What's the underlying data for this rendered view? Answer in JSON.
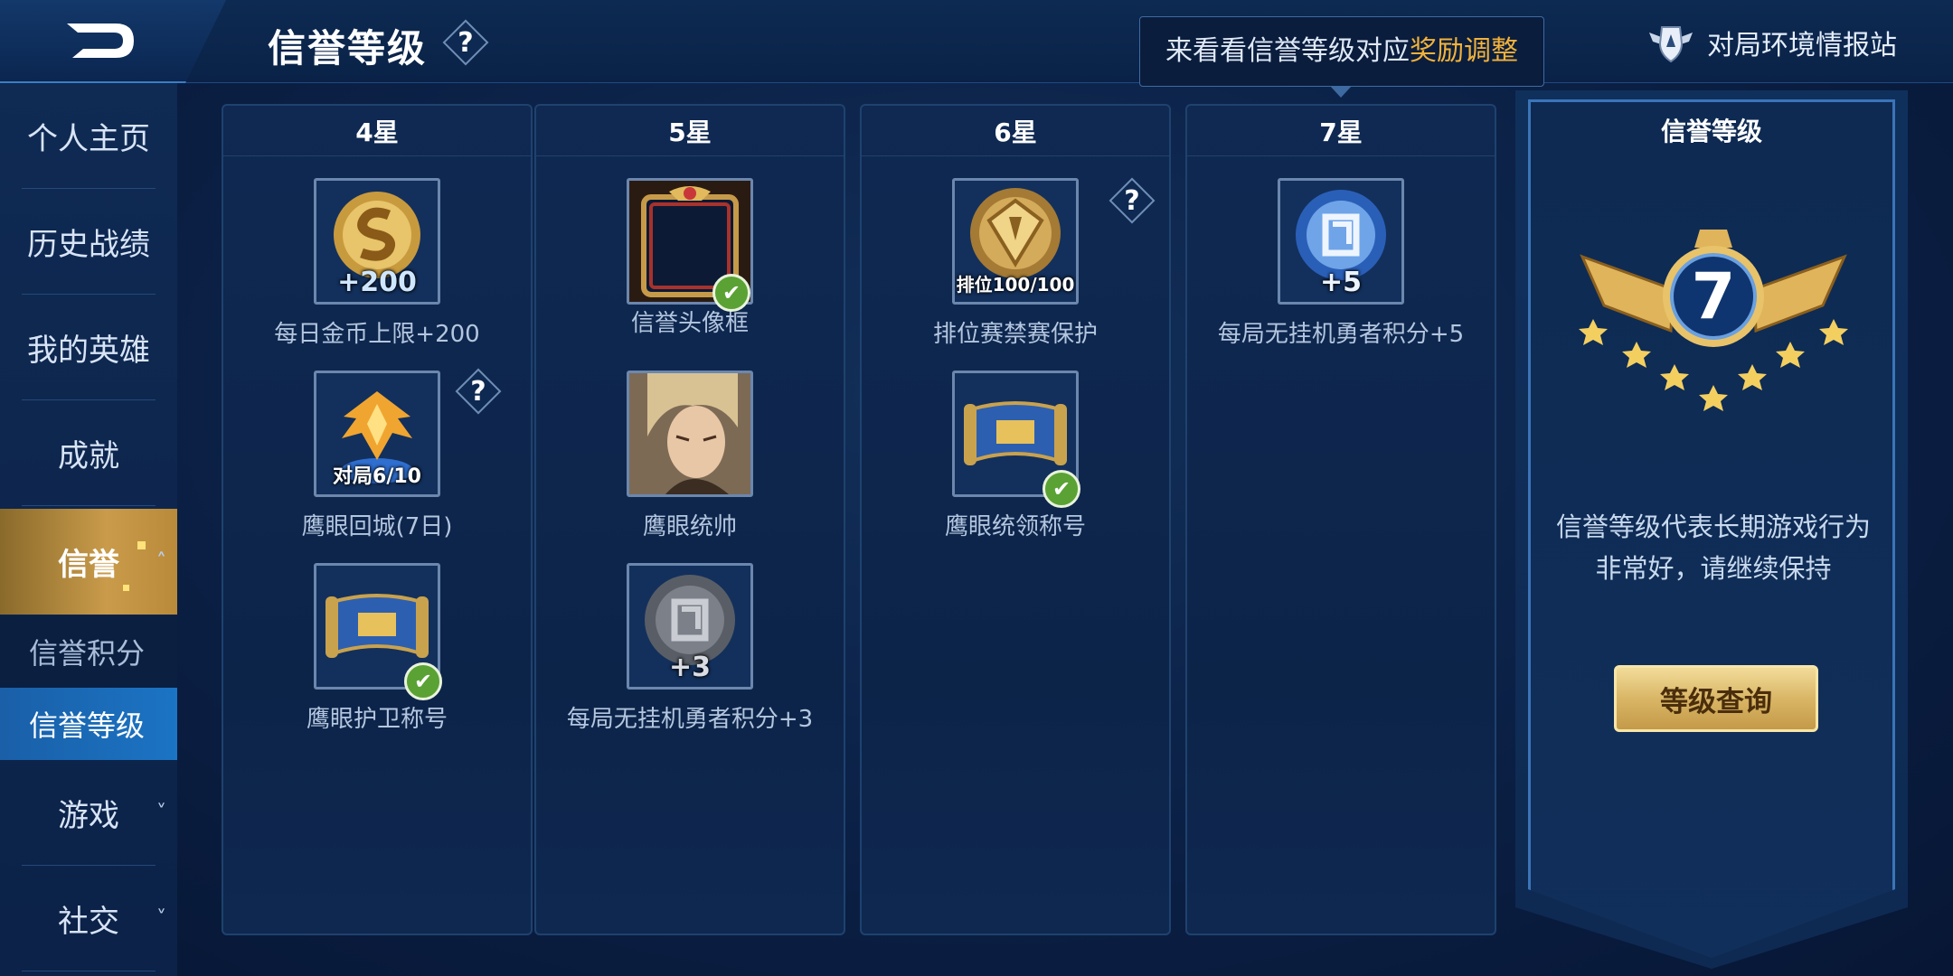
{
  "header": {
    "back_icon": "back-arrow-icon",
    "title": "信誉等级",
    "help_glyph": "?",
    "tip_prefix": "来看看信誉等级对应",
    "tip_highlight": "奖励调整",
    "station_label": "对局环境情报站",
    "station_icon": "shield-wings-icon"
  },
  "sidebar": {
    "items": [
      {
        "label": "个人主页"
      },
      {
        "label": "历史战绩"
      },
      {
        "label": "我的英雄"
      },
      {
        "label": "成就"
      },
      {
        "label": "信誉",
        "chevron": "˄"
      },
      {
        "label": "游戏",
        "chevron": "˅"
      },
      {
        "label": "社交",
        "chevron": "˅"
      }
    ],
    "sub_items": [
      {
        "label": "信誉积分"
      },
      {
        "label": "信誉等级"
      }
    ]
  },
  "columns": [
    {
      "header": "4星",
      "items": [
        {
          "icon": "gold-coin-icon",
          "tag": "+200",
          "label": "每日金币上限+200"
        },
        {
          "icon": "eagle-return-icon",
          "tag": "对局6/10",
          "label": "鹰眼回城(7日)"
        },
        {
          "icon": "title-scroll-icon",
          "label": "鹰眼护卫称号",
          "check": "✔"
        }
      ]
    },
    {
      "header": "5星",
      "items": [
        {
          "icon": "avatar-frame-icon",
          "label": "信誉头像框",
          "check": "✔"
        },
        {
          "icon": "hero-portrait-icon",
          "label": "鹰眼统帅"
        },
        {
          "icon": "brave-points-grey-icon",
          "tag": "+3",
          "label": "每局无挂机勇者积分+3"
        }
      ]
    },
    {
      "header": "6星",
      "items": [
        {
          "icon": "rank-protection-icon",
          "tag": "排位100/100",
          "label": "排位赛禁赛保护"
        },
        {
          "icon": "title-scroll-icon",
          "label": "鹰眼统领称号",
          "check": "✔"
        }
      ]
    },
    {
      "header": "7星",
      "items": [
        {
          "icon": "brave-points-blue-icon",
          "tag": "+5",
          "label": "每局无挂机勇者积分+5"
        }
      ]
    }
  ],
  "panel": {
    "title": "信誉等级",
    "level": "7",
    "badge_icon": "winged-level-badge-icon",
    "desc_line1": "信誉等级代表长期游戏行为",
    "desc_line2": "非常好，请继续保持",
    "button_label": "等级查询"
  },
  "colors": {
    "accent_gold": "#f2b23a",
    "active_tab_blue": "#1b74c4",
    "check_green": "#5aa234"
  }
}
